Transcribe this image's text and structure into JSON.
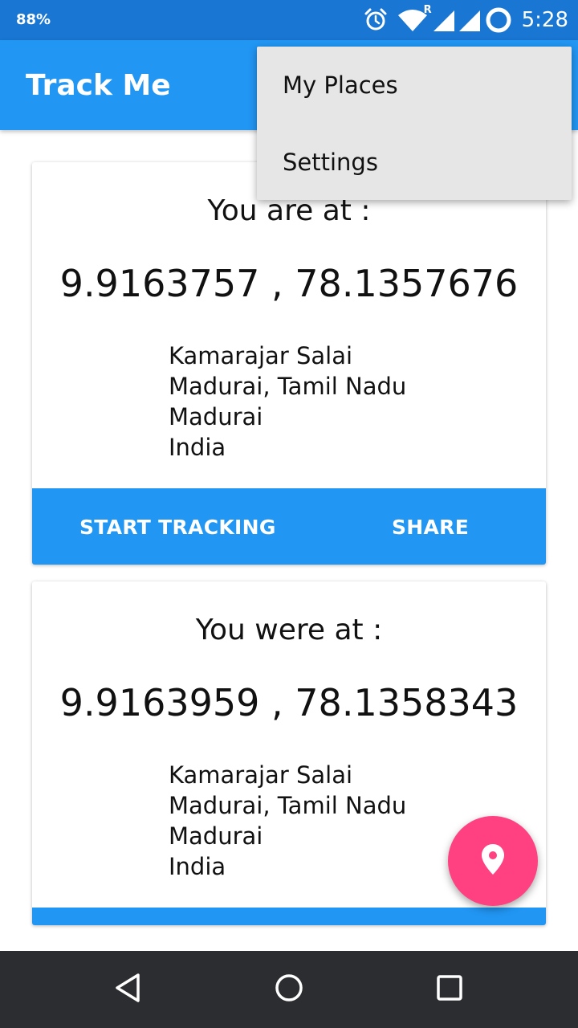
{
  "status_bar": {
    "battery": "88%",
    "time": "5:28",
    "icons": [
      "alarm-icon",
      "wifi-icon",
      "signal-icon",
      "battery-icon"
    ],
    "roaming_indicator": "R"
  },
  "app_bar": {
    "title": "Track Me",
    "color": "#2196f3"
  },
  "overflow_menu": {
    "items": [
      {
        "label": "My Places"
      },
      {
        "label": "Settings"
      }
    ]
  },
  "current_location": {
    "heading": "You are at :",
    "coordinates": "9.9163757 , 78.1357676",
    "address": [
      "Kamarajar Salai",
      "Madurai, Tamil Nadu",
      "Madurai",
      "India"
    ],
    "actions": {
      "start_tracking": "START TRACKING",
      "share": "SHARE"
    }
  },
  "previous_location": {
    "heading": "You were at :",
    "coordinates": "9.9163959 , 78.1358343",
    "address": [
      "Kamarajar Salai",
      "Madurai, Tamil Nadu",
      "Madurai",
      "India"
    ]
  },
  "fab": {
    "icon": "location-pin-icon",
    "color": "#ff4081"
  },
  "nav_bar": {
    "buttons": [
      "back-icon",
      "home-icon",
      "recents-icon"
    ]
  }
}
